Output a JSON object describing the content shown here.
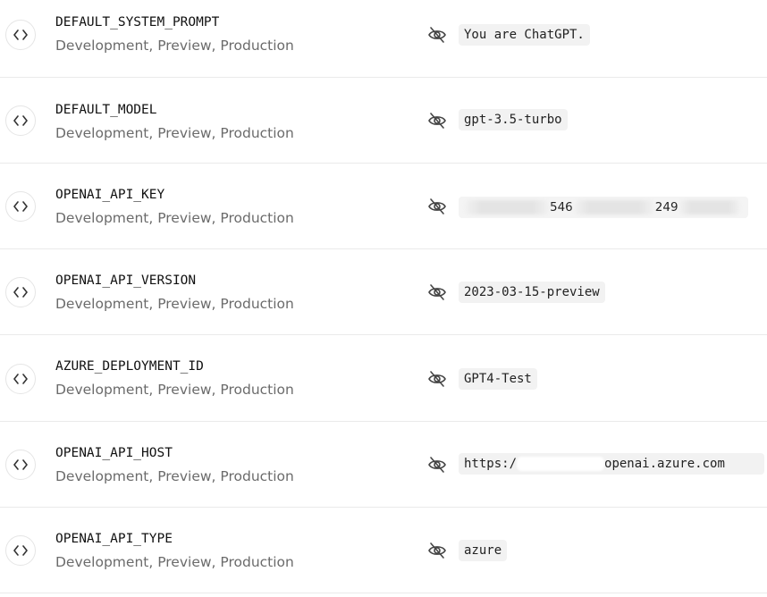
{
  "env_vars": [
    {
      "name": "DEFAULT_SYSTEM_PROMPT",
      "targets": "Development, Preview, Production",
      "value": "You are ChatGPT."
    },
    {
      "name": "DEFAULT_MODEL",
      "targets": "Development, Preview, Production",
      "value": "gpt-3.5-turbo"
    },
    {
      "name": "OPENAI_API_KEY",
      "targets": "Development, Preview, Production",
      "value_parts": [
        "546",
        "249"
      ]
    },
    {
      "name": "OPENAI_API_VERSION",
      "targets": "Development, Preview, Production",
      "value": "2023-03-15-preview"
    },
    {
      "name": "AZURE_DEPLOYMENT_ID",
      "targets": "Development, Preview, Production",
      "value": "GPT4-Test"
    },
    {
      "name": "OPENAI_API_HOST",
      "targets": "Development, Preview, Production",
      "value_parts": [
        "https:/",
        "openai.azure.com"
      ]
    },
    {
      "name": "OPENAI_API_TYPE",
      "targets": "Development, Preview, Production",
      "value": "azure"
    }
  ],
  "icons": {
    "row_icon": "code-icon",
    "visibility_icon": "eye-off-icon"
  },
  "colors": {
    "name_text": "#111111",
    "targets_text": "#6b6b6b",
    "value_background": "#f2f2f2",
    "divider": "#eaeaea"
  }
}
